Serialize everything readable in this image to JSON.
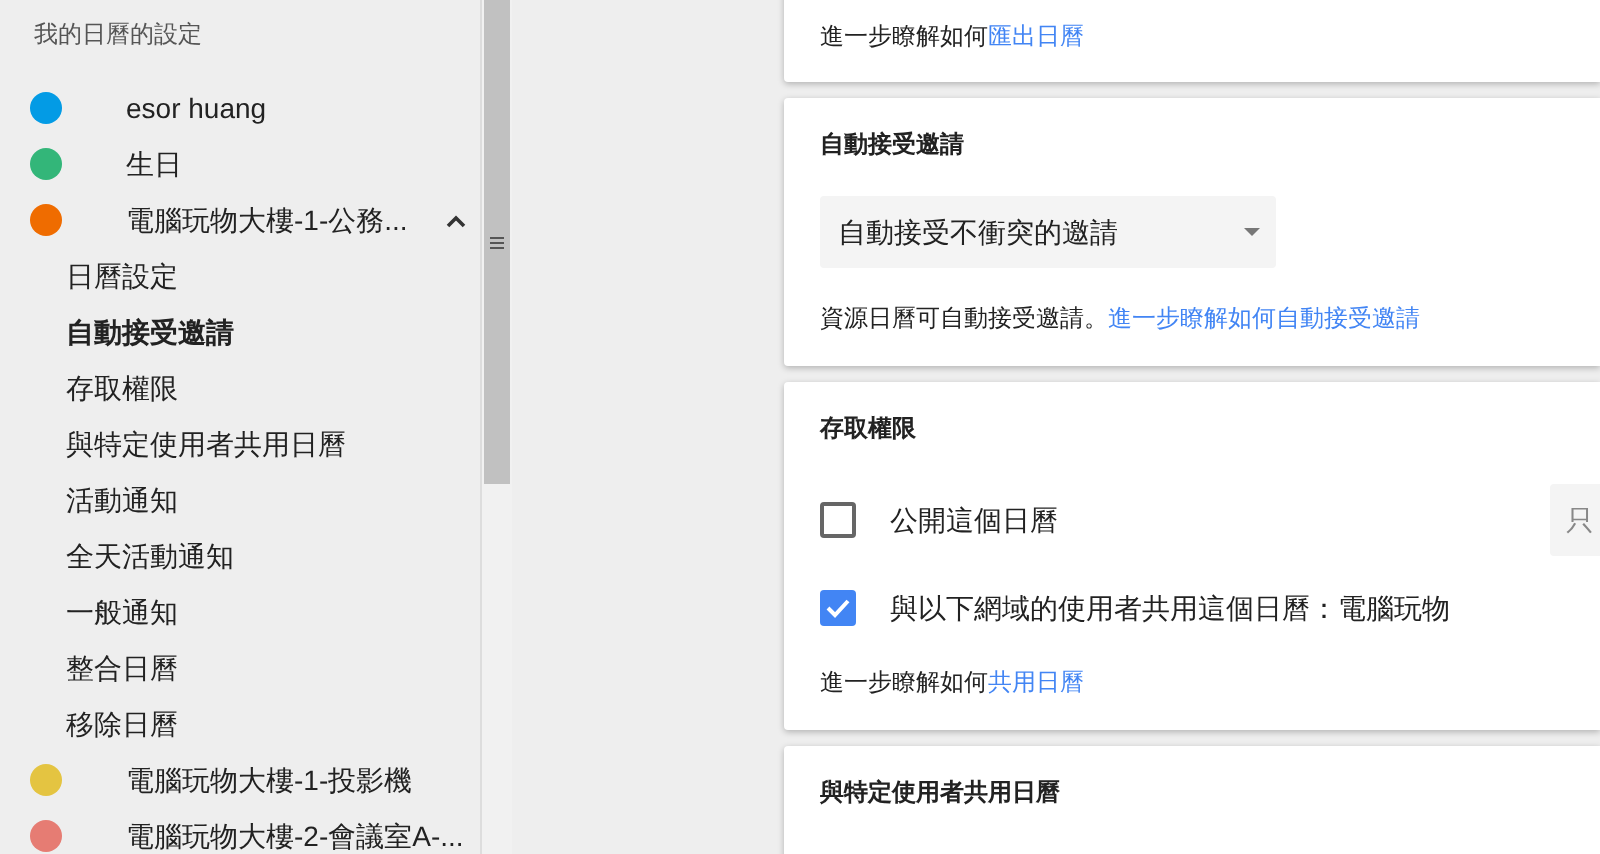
{
  "sidebar": {
    "heading": "我的日曆的設定",
    "calendars": [
      {
        "name": "esor huang",
        "color": "#039be5",
        "expanded": false
      },
      {
        "name": "生日",
        "color": "#33b679",
        "expanded": false
      },
      {
        "name": "電腦玩物大樓-1-公務...",
        "color": "#ef6c00",
        "expanded": true,
        "children": [
          {
            "label": "日曆設定",
            "selected": false
          },
          {
            "label": "自動接受邀請",
            "selected": true
          },
          {
            "label": "存取權限",
            "selected": false
          },
          {
            "label": "與特定使用者共用日曆",
            "selected": false
          },
          {
            "label": "活動通知",
            "selected": false
          },
          {
            "label": "全天活動通知",
            "selected": false
          },
          {
            "label": "一般通知",
            "selected": false
          },
          {
            "label": "整合日曆",
            "selected": false
          },
          {
            "label": "移除日曆",
            "selected": false
          }
        ]
      },
      {
        "name": "電腦玩物大樓-1-投影機",
        "color": "#e4c441",
        "expanded": false
      },
      {
        "name": "電腦玩物大樓-2-會議室A-...",
        "color": "#e67c73",
        "expanded": false
      }
    ]
  },
  "sections": [
    {
      "kind": "help",
      "help_text": "進一步瞭解如何",
      "help_link": "匯出日曆"
    },
    {
      "kind": "dropdown",
      "title": "自動接受邀請",
      "dropdown_value": "自動接受不衝突的邀請",
      "note": "資源日曆可自動接受邀請。",
      "help_link": "進一步瞭解如何自動接受邀請"
    },
    {
      "kind": "checkboxes",
      "title": "存取權限",
      "options": [
        {
          "label": "公開這個日曆",
          "checked": false,
          "side_dropdown": "只"
        },
        {
          "label": "與以下網域的使用者共用這個日曆：電腦玩物",
          "checked": true
        }
      ],
      "help_text": "進一步瞭解如何",
      "help_link": "共用日曆"
    },
    {
      "kind": "title_only",
      "title": "與特定使用者共用日曆"
    }
  ]
}
